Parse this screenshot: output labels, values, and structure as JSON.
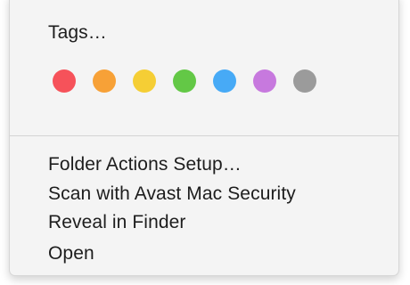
{
  "menu": {
    "tags_label": "Tags…",
    "tag_colors": [
      {
        "name": "red",
        "hex": "#f6525a"
      },
      {
        "name": "orange",
        "hex": "#f7a137"
      },
      {
        "name": "yellow",
        "hex": "#f5ce35"
      },
      {
        "name": "green",
        "hex": "#63c846"
      },
      {
        "name": "blue",
        "hex": "#47aaf6"
      },
      {
        "name": "purple",
        "hex": "#c779de"
      },
      {
        "name": "gray",
        "hex": "#9b9b9b"
      }
    ],
    "items": [
      {
        "label": "Folder Actions Setup…"
      },
      {
        "label": "Scan with Avast Mac Security"
      },
      {
        "label": "Reveal in Finder"
      },
      {
        "label": "Open"
      }
    ]
  }
}
